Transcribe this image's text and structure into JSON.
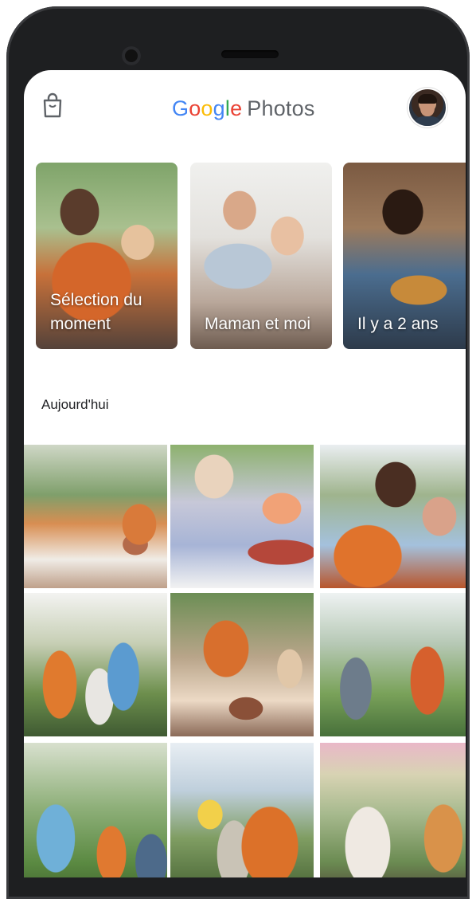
{
  "header": {
    "logo_letters": [
      "G",
      "o",
      "o",
      "g",
      "l",
      "e"
    ],
    "product": "Photos",
    "bag_icon": "shopping-bag-icon",
    "avatar_icon": "account-avatar"
  },
  "memories": [
    {
      "label": "Sélection du moment"
    },
    {
      "label": "Maman et moi"
    },
    {
      "label": "Il y a 2 ans"
    }
  ],
  "section": {
    "title": "Aujourd'hui"
  },
  "colors": {
    "google_blue": "#4285F4",
    "google_red": "#EA4335",
    "google_yellow": "#FBBC05",
    "google_green": "#34A853",
    "product_text": "#5f6368"
  }
}
